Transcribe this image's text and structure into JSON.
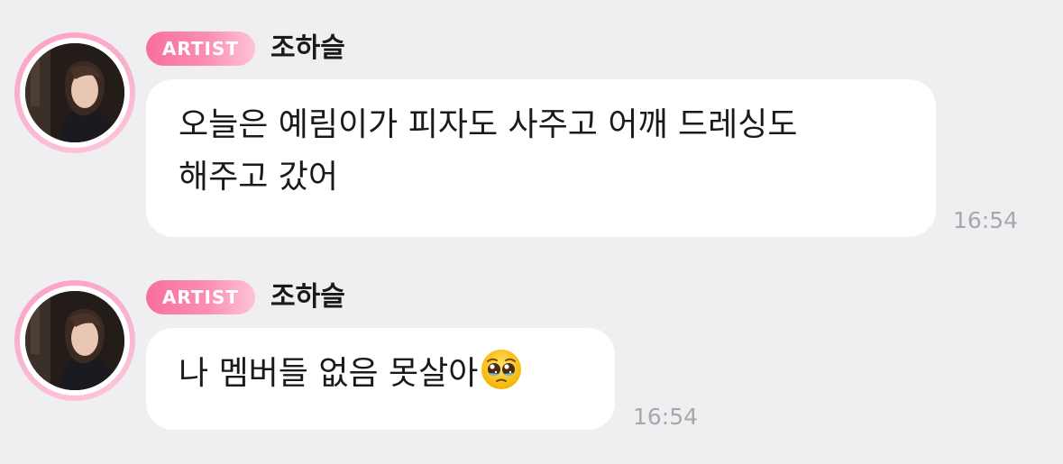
{
  "colors": {
    "background": "#efeff1",
    "bubble": "#ffffff",
    "badge_start": "#f86f9e",
    "badge_end": "#ffc3d6",
    "timestamp": "#a8a8ac"
  },
  "messages": [
    {
      "badge": "ARTIST",
      "sender": "조하슬",
      "lines": [
        "오늘은 예림이가 피자도 사주고 어깨 드레싱도",
        "해주고 갔어"
      ],
      "time": "16:54",
      "avatar_icon": "profile-photo"
    },
    {
      "badge": "ARTIST",
      "sender": "조하슬",
      "text": "나 멤버들 없음 못살아",
      "emoji": "pleading-face-emoji",
      "time": "16:54",
      "avatar_icon": "profile-photo"
    }
  ]
}
